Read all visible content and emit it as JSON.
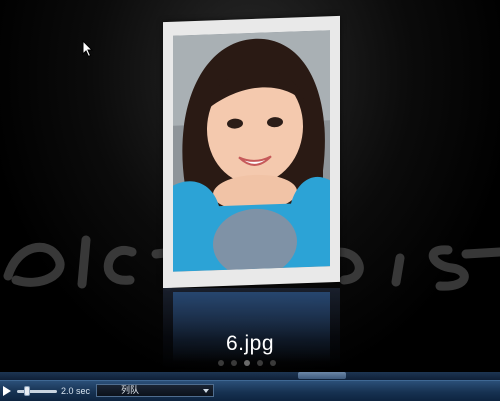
{
  "viewer": {
    "current_file": "6.jpg",
    "slide_count": 5,
    "active_slide": 3
  },
  "controls": {
    "play_icon": "play-icon",
    "interval": "2.0 sec",
    "interval_value": 0.35,
    "playlist_label": "列队",
    "dropdown_icon": "chevron-down-icon",
    "progress": 0.66
  },
  "colors": {
    "background": "#000000",
    "control_bar": "#173252",
    "card": "#e9e9e9"
  }
}
